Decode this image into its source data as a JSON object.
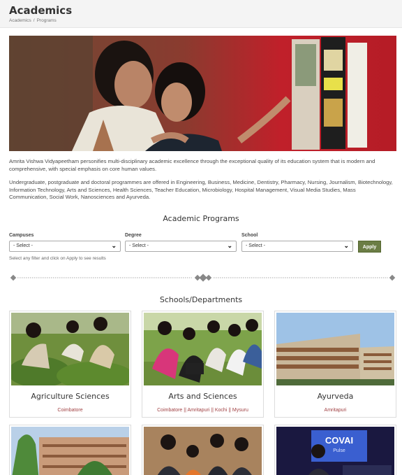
{
  "header": {
    "title": "Academics",
    "breadcrumb": [
      "Academics",
      "/",
      "Programs"
    ]
  },
  "intro": {
    "p1": "Amrita Vishwa Vidyapeetham personifies multi-disciplinary academic excellence through the exceptional quality of its education system that is modern and comprehensive, with special emphasis on core human values.",
    "p2": "Undergraduate, postgraduate and doctoral programmes are offered in Engineering, Business, Medicine, Dentistry, Pharmacy, Nursing, Journalism, Biotechnology, Information Technology, Arts and Sciences, Health Sciences, Teacher Education, Microbiology, Hospital Management, Visual Media Studies, Mass Communication, Social Work, Nanosciences and Ayurveda."
  },
  "programs": {
    "title": "Academic Programs",
    "filters": [
      {
        "label": "Campuses",
        "value": "- Select -"
      },
      {
        "label": "Degree",
        "value": "- Select -"
      },
      {
        "label": "School",
        "value": "- Select -"
      }
    ],
    "apply_label": "Apply",
    "help": "Select any filter and click on Apply to see results"
  },
  "schools": {
    "title": "Schools/Departments",
    "cards": [
      {
        "name": "Agriculture Sciences",
        "campus": "Coimbatore"
      },
      {
        "name": "Arts and Sciences",
        "campus": "Coimbatore || Amritapuri || Kochi || Mysuru"
      },
      {
        "name": "Ayurveda",
        "campus": "Amritapuri"
      },
      {
        "name": "",
        "campus": ""
      },
      {
        "name": "",
        "campus": ""
      },
      {
        "name": "",
        "campus": ""
      }
    ],
    "poster_text": {
      "brand": "COVAI",
      "sub": "Pulse"
    }
  },
  "icons": {
    "select_chevron": "chevron-down-icon",
    "divider_ornament": "diamond-icon"
  },
  "colors": {
    "accent_green": "#6b7d45",
    "campus_text": "#a14244",
    "hero_red": "#c0202a"
  }
}
